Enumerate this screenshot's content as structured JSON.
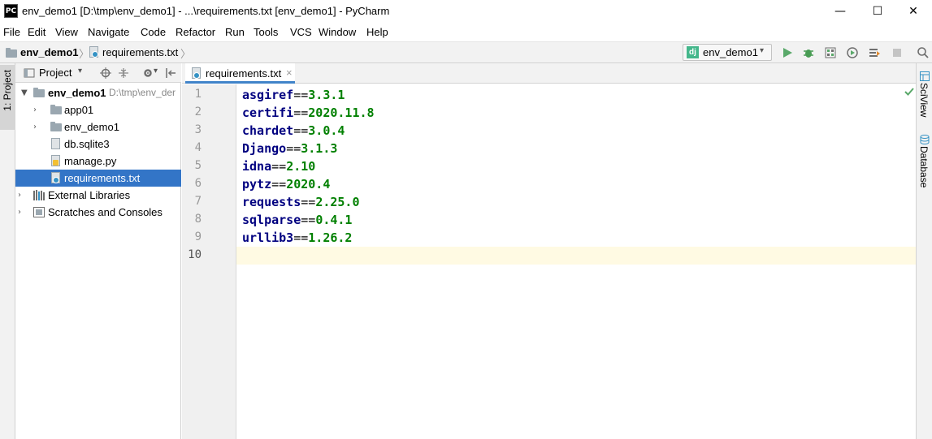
{
  "window": {
    "app_icon_text": "PC",
    "title": "env_demo1 [D:\\tmp\\env_demo1] - ...\\requirements.txt [env_demo1] - PyCharm",
    "minimize": "—",
    "maximize": "☐",
    "close": "✕"
  },
  "menu": [
    {
      "label": "File"
    },
    {
      "label": "Edit"
    },
    {
      "label": "View"
    },
    {
      "label": "Navigate"
    },
    {
      "label": "Code"
    },
    {
      "label": "Refactor"
    },
    {
      "label": "Run"
    },
    {
      "label": "Tools"
    },
    {
      "label": "VCS"
    },
    {
      "label": "Window"
    },
    {
      "label": "Help"
    }
  ],
  "breadcrumb": {
    "project": "env_demo1",
    "file": "requirements.txt"
  },
  "run_config": {
    "icon_text": "dj",
    "label": "env_demo1"
  },
  "left_strip": {
    "project_tab": "1: Project"
  },
  "project_panel": {
    "view_label": "Project",
    "tree": [
      {
        "label": "env_demo1",
        "path": "D:\\tmp\\env_der",
        "icon": "folder-icon",
        "expanded": true
      },
      {
        "label": "app01",
        "icon": "folder-icon"
      },
      {
        "label": "env_demo1",
        "icon": "folder-icon"
      },
      {
        "label": "db.sqlite3",
        "icon": "database-file-icon"
      },
      {
        "label": "manage.py",
        "icon": "python-file-icon"
      },
      {
        "label": "requirements.txt",
        "icon": "text-file-icon",
        "selected": true
      },
      {
        "label": "External Libraries",
        "icon": "library-icon"
      },
      {
        "label": "Scratches and Consoles",
        "icon": "scratches-icon"
      }
    ]
  },
  "editor": {
    "tab_label": "requirements.txt",
    "tab_close": "×",
    "line_numbers": [
      "1",
      "2",
      "3",
      "4",
      "5",
      "6",
      "7",
      "8",
      "9",
      "10"
    ],
    "lines": [
      {
        "pkg": "asgiref",
        "op": "==",
        "ver": "3.3.1"
      },
      {
        "pkg": "certifi",
        "op": "==",
        "ver": "2020.11.8"
      },
      {
        "pkg": "chardet",
        "op": "==",
        "ver": "3.0.4"
      },
      {
        "pkg": "Django",
        "op": "==",
        "ver": "3.1.3"
      },
      {
        "pkg": "idna",
        "op": "==",
        "ver": "2.10"
      },
      {
        "pkg": "pytz",
        "op": "==",
        "ver": "2020.4"
      },
      {
        "pkg": "requests",
        "op": "==",
        "ver": "2.25.0"
      },
      {
        "pkg": "sqlparse",
        "op": "==",
        "ver": "0.4.1"
      },
      {
        "pkg": "urllib3",
        "op": "==",
        "ver": "1.26.2"
      }
    ]
  },
  "right_strip": {
    "sciview": "SciView",
    "database": "Database"
  },
  "colors": {
    "selection": "#3375c7",
    "package_name": "#000080",
    "version": "#008000",
    "current_line": "#fffae3"
  }
}
